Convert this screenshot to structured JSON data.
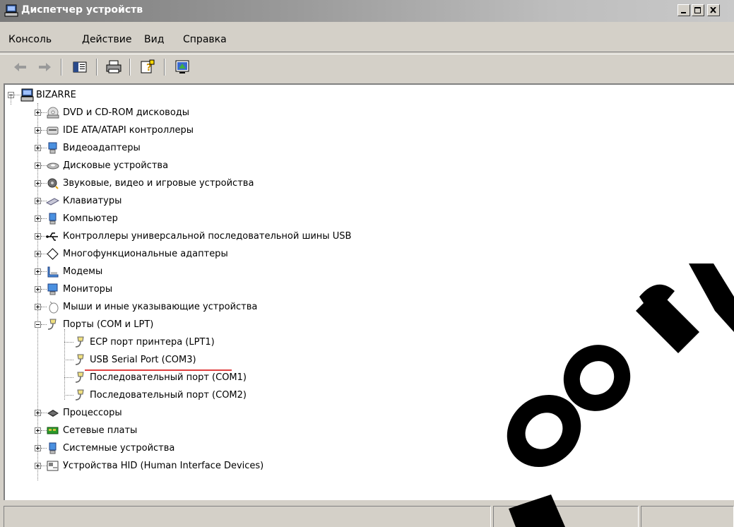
{
  "window": {
    "title": "Диспетчер устройств"
  },
  "menu": [
    "Консоль",
    "Действие",
    "Вид",
    "Справка"
  ],
  "toolbar_icons": [
    "back-arrow-icon",
    "forward-arrow-icon",
    "properties-pane-icon",
    "print-icon",
    "help-icon",
    "scan-hardware-icon"
  ],
  "tree": {
    "root": "BIZARRE",
    "categories": [
      {
        "label": "DVD и CD-ROM дисководы",
        "icon": "cdrom-icon"
      },
      {
        "label": "IDE ATA/ATAPI контроллеры",
        "icon": "ide-controller-icon"
      },
      {
        "label": "Видеоадаптеры",
        "icon": "display-adapter-icon"
      },
      {
        "label": "Дисковые устройства",
        "icon": "disk-drive-icon"
      },
      {
        "label": "Звуковые, видео и игровые устройства",
        "icon": "sound-icon"
      },
      {
        "label": "Клавиатуры",
        "icon": "keyboard-icon"
      },
      {
        "label": "Компьютер",
        "icon": "computer-icon"
      },
      {
        "label": "Контроллеры универсальной последовательной шины USB",
        "icon": "usb-icon"
      },
      {
        "label": "Многофункциональные адаптеры",
        "icon": "multifunction-icon"
      },
      {
        "label": "Модемы",
        "icon": "modem-icon"
      },
      {
        "label": "Мониторы",
        "icon": "monitor-icon"
      },
      {
        "label": "Мыши и иные указывающие устройства",
        "icon": "mouse-icon"
      },
      {
        "label": "Порты (COM и LPT)",
        "icon": "port-icon",
        "expanded": true,
        "children": [
          "ECP порт принтера (LPT1)",
          "USB Serial Port (COM3)",
          "Последовательный порт (COM1)",
          "Последовательный порт (COM2)"
        ]
      },
      {
        "label": "Процессоры",
        "icon": "processor-icon"
      },
      {
        "label": "Сетевые платы",
        "icon": "network-card-icon"
      },
      {
        "label": "Системные устройства",
        "icon": "system-devices-icon"
      },
      {
        "label": "Устройства HID (Human Interface Devices)",
        "icon": "hid-icon"
      }
    ]
  },
  "highlight": {
    "item": "USB Serial Port (COM3)",
    "underline_color": "#e04040"
  },
  "watermark_color": "#000000"
}
